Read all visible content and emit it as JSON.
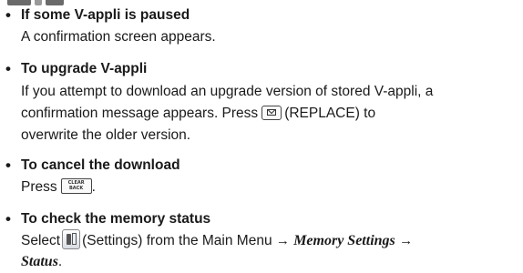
{
  "items": [
    {
      "heading": "If some V-appli is paused",
      "body": "A confirmation screen appears."
    },
    {
      "heading": "To upgrade V-appli",
      "line1": "If you attempt to download an upgrade version of stored V-appli, a",
      "line2_before": "confirmation message appears. Press",
      "line2_after": "(REPLACE) to",
      "line3": "overwrite the older version."
    },
    {
      "heading": "To cancel the download",
      "body_before": "Press",
      "body_after": ".",
      "key_line1": "CLEAR",
      "key_line2": "BACK"
    },
    {
      "heading": "To check the memory status",
      "line1_before": "Select",
      "line1_middle": "(Settings) from the Main Menu",
      "arrow": "→",
      "path1": "Memory Settings",
      "path2": "Status",
      "line2_after": "."
    }
  ],
  "bullet": "•",
  "icons": {
    "mail_key": "mail-key-icon",
    "clear_key": "clear-back-key-icon",
    "settings": "settings-icon"
  }
}
